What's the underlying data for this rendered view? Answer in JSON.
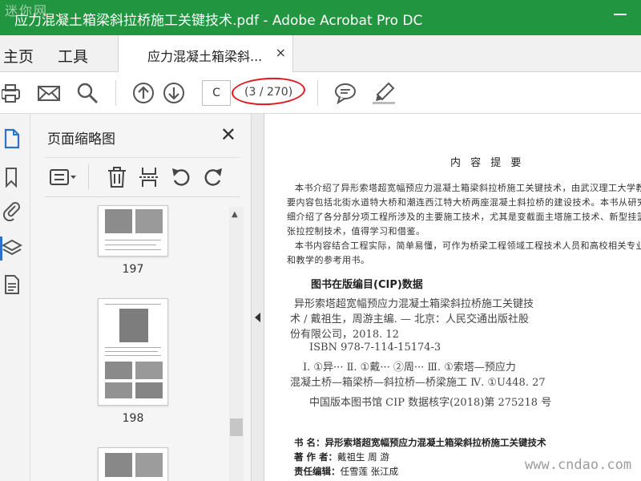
{
  "window": {
    "title": "应力混凝土箱梁斜拉桥施工关键技术.pdf - Adobe Acrobat Pro DC",
    "watermark_top": "迷你网"
  },
  "tabs": {
    "home": "主页",
    "tools": "工具",
    "document": "应力混凝土箱梁斜...",
    "close_glyph": "×"
  },
  "toolbar": {
    "page_input": "C",
    "page_count": "(3 / 270)",
    "icons": [
      "print-icon",
      "email-icon",
      "search-icon",
      "prev-page-icon",
      "next-page-icon",
      "comment-icon",
      "highlight-pen-icon"
    ]
  },
  "thumbnails_panel": {
    "title": "页面缩略图",
    "close_glyph": "✕",
    "items": [
      {
        "page": "197"
      },
      {
        "page": "198"
      }
    ]
  },
  "document": {
    "section_title": "内  容  提  要",
    "paragraphs": [
      "本书介绍了异形索塔超宽幅预应力混凝土箱梁斜拉桥施工关键技术，由武汉理工大学教授",
      "要内容包括北街水道特大桥和潮连西江特大桥两座混凝土斜拉桥的建设技术。本书从研究及应",
      "细介绍了各分部分项工程所涉及的主要施工技术，尤其是变截面主塔施工技术、新型挂篮施工技",
      "张拉控制技术，值得学习和借鉴。",
      "本书内容结合工程实际，简单易懂，可作为桥梁工程领域工程技术人员和高校相关专业师",
      "和教学的参考用书。"
    ],
    "cip_heading": "图书在版编目(CIP)数据",
    "cip_lines": [
      "异形索塔超宽幅预应力混凝土箱梁斜拉桥施工关键技",
      "术 / 戴祖生，周游主编. — 北京：人民交通出版社股",
      "份有限公司，2018. 12",
      "ISBN  978-7-114-15174-3",
      "Ⅰ. ①异···   Ⅱ. ①戴···  ②周···   Ⅲ. ①索塔—预应力",
      "混凝土桥—箱梁桥—斜拉桥—桥梁施工   Ⅳ. ①U448. 27",
      "中国版本图书馆 CIP 数据核字(2018)第 275218 号"
    ],
    "meta": [
      {
        "label": "书      名：",
        "value": "异形索塔超宽幅预应力混凝土箱梁斜拉桥施工关键技术"
      },
      {
        "label": "著  作  者：",
        "value": "戴祖生   周   游"
      },
      {
        "label": "责任编辑：",
        "value": "任雪莲   张江成"
      }
    ],
    "watermark": "www.cndao.com"
  },
  "colors": {
    "titlebar": "#21953f",
    "annotation_red": "#e0161c",
    "rail_active": "#2b72c8"
  }
}
